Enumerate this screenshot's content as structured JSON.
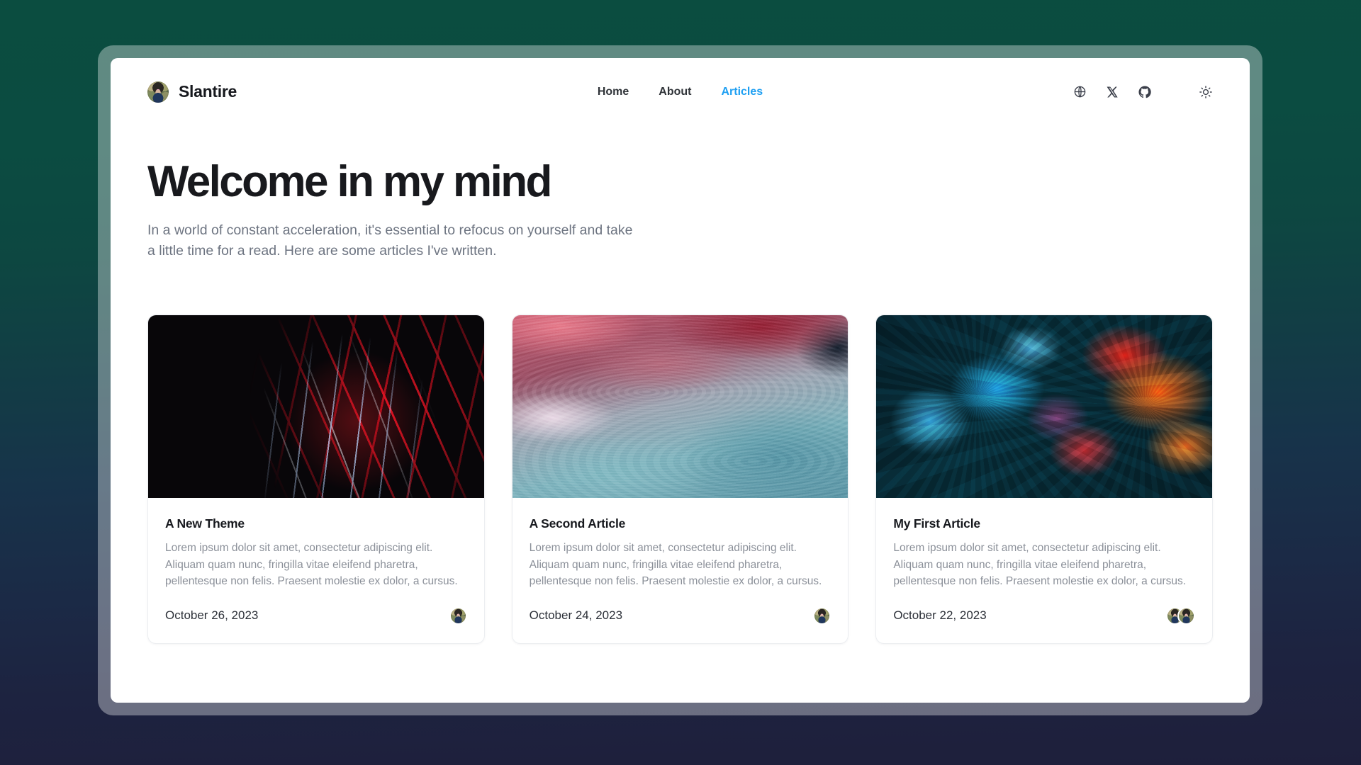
{
  "site": {
    "brand": "Slantire",
    "accent_color": "#1e9ff2",
    "background_top_color": "#0b4d40",
    "background_bottom_color": "#1e1f3b"
  },
  "nav": {
    "items": [
      {
        "label": "Home",
        "active": false
      },
      {
        "label": "About",
        "active": false
      },
      {
        "label": "Articles",
        "active": true
      }
    ]
  },
  "actions": {
    "icons": [
      {
        "name": "globe-icon",
        "title": "Language"
      },
      {
        "name": "x-twitter-icon",
        "title": "X"
      },
      {
        "name": "github-icon",
        "title": "GitHub"
      },
      {
        "name": "sun-icon",
        "title": "Toggle theme"
      }
    ]
  },
  "hero": {
    "title": "Welcome in my mind",
    "subtitle": "In a world of constant acceleration, it's essential to refocus on yourself and take a little time for a read. Here are some articles I've written."
  },
  "articles": [
    {
      "title": "A New Theme",
      "excerpt": "Lorem ipsum dolor sit amet, consectetur adipiscing elit. Aliquam quam nunc, fringilla vitae eleifend pharetra, pellentesque non felis. Praesent molestie ex dolor, a cursus.",
      "date": "October 26, 2023",
      "image": "red-light-trails-on-black",
      "authors": 1
    },
    {
      "title": "A Second Article",
      "excerpt": "Lorem ipsum dolor sit amet, consectetur adipiscing elit. Aliquam quam nunc, fringilla vitae eleifend pharetra, pellentesque non felis. Praesent molestie ex dolor, a cursus.",
      "date": "October 24, 2023",
      "image": "pink-and-teal-liquid-marble",
      "authors": 1
    },
    {
      "title": "My First Article",
      "excerpt": "Lorem ipsum dolor sit amet, consectetur adipiscing elit. Aliquam quam nunc, fringilla vitae eleifend pharetra, pellentesque non felis. Praesent molestie ex dolor, a cursus.",
      "date": "October 22, 2023",
      "image": "blue-and-orange-ink-in-water",
      "authors": 2
    }
  ]
}
